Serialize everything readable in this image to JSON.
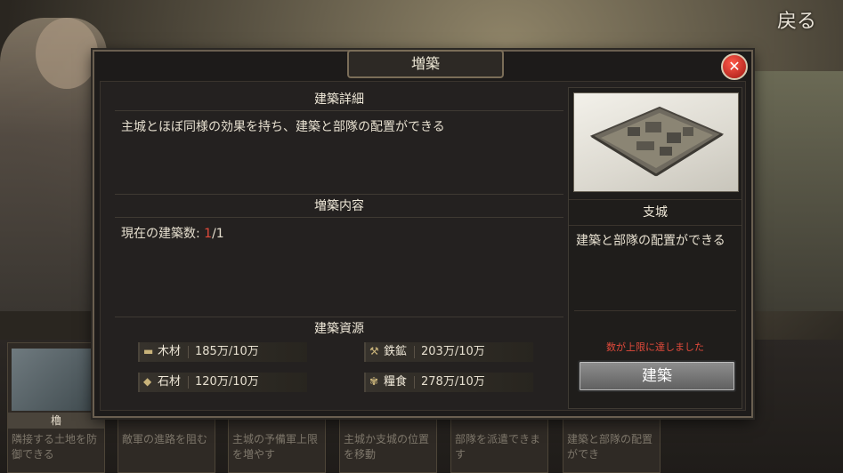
{
  "background": {
    "back_label": "戻る",
    "cards": [
      {
        "name": "櫓",
        "desc": "隣接する土地を防御できる"
      },
      {
        "name": "",
        "desc": "敵軍の進路を阻む"
      },
      {
        "name": "",
        "desc": "主城の予備軍上限を増やす"
      },
      {
        "name": "",
        "desc": "主城か支城の位置を移動"
      },
      {
        "name": "",
        "desc": "部隊を派遣できます"
      },
      {
        "name": "",
        "desc": "建築と部隊の配置ができ"
      }
    ]
  },
  "dialog": {
    "title": "増築",
    "close_icon": "close-icon",
    "details": {
      "heading": "建築詳細",
      "text": "主城とほぼ同様の効果を持ち、建築と部隊の配置ができる"
    },
    "content": {
      "heading": "増築内容",
      "label": "現在の建築数:",
      "current": "1",
      "max": "/1"
    },
    "resources": {
      "heading": "建築資源",
      "items": [
        {
          "icon": "wood-icon",
          "name": "木材",
          "value": "185万/10万"
        },
        {
          "icon": "iron-icon",
          "name": "鉄鉱",
          "value": "203万/10万"
        },
        {
          "icon": "stone-icon",
          "name": "石材",
          "value": "120万/10万"
        },
        {
          "icon": "food-icon",
          "name": "糧食",
          "value": "278万/10万"
        }
      ]
    },
    "side": {
      "name": "支城",
      "desc": "建築と部隊の配置ができる",
      "warning": "数が上限に達しました",
      "build_label": "建築"
    }
  },
  "colors": {
    "accent_red": "#e24a3b",
    "panel_bg": "#242120"
  }
}
